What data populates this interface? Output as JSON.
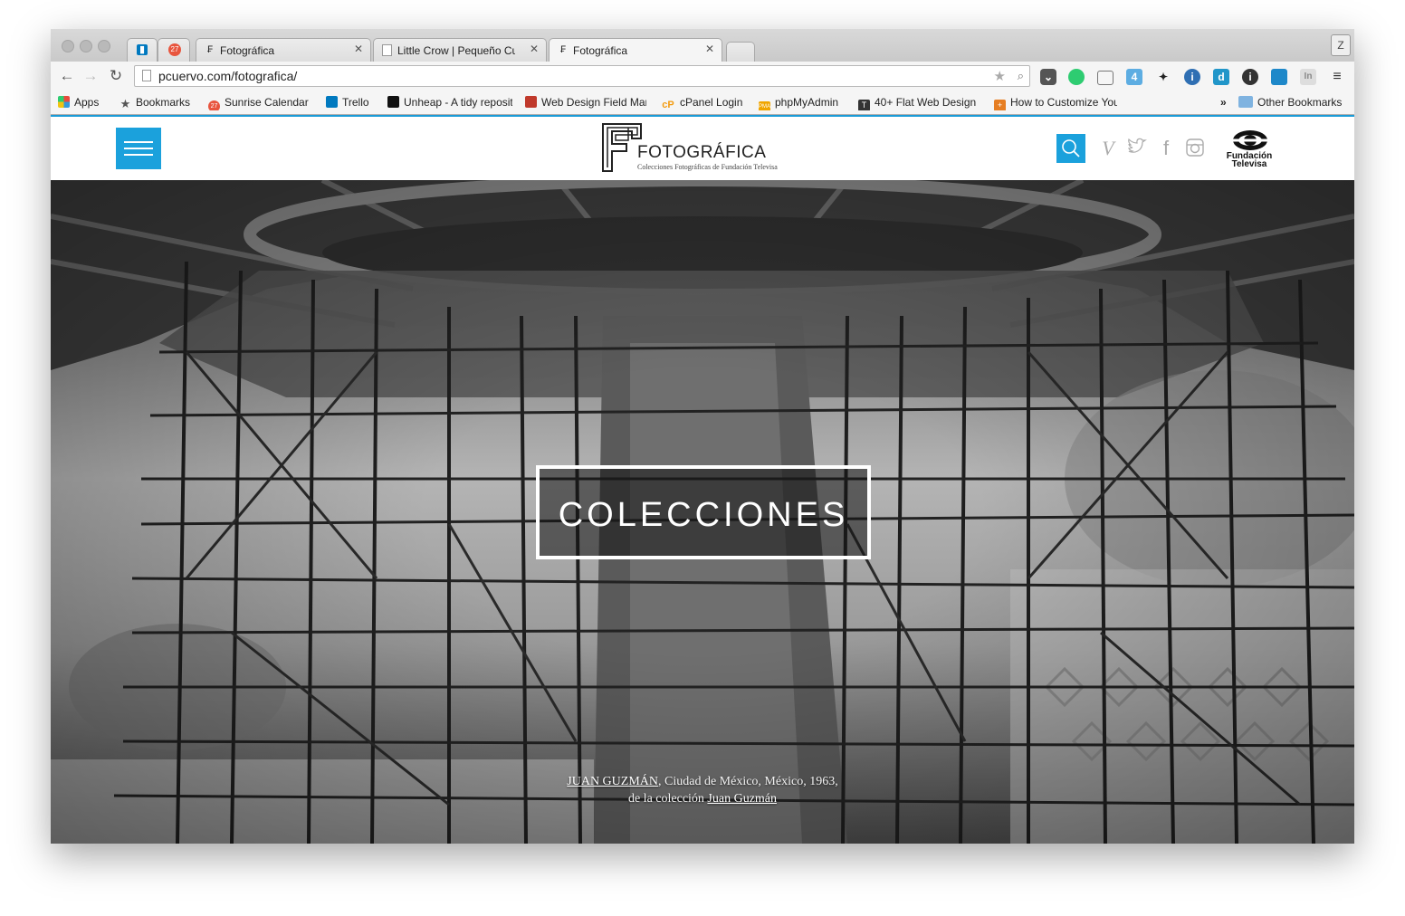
{
  "browser": {
    "tabs": [
      {
        "label": "",
        "icon": "trello-icon"
      },
      {
        "label": "",
        "icon": "calendar-27-icon",
        "badge": "27"
      },
      {
        "label": "Fotográfica",
        "icon": "fotografica-icon"
      },
      {
        "label": "Little Crow | Pequeño Cuervo",
        "icon": "page-icon"
      },
      {
        "label": "Fotográfica",
        "icon": "fotografica-icon"
      }
    ],
    "profile": "Z",
    "url": "pcuervo.com/fotografica/",
    "bookmarks": [
      {
        "label": "Apps",
        "icon": "apps-grid-icon",
        "color": "#e84a3c"
      },
      {
        "label": "Bookmarks",
        "icon": "star-icon",
        "color": "#555555"
      },
      {
        "label": "Sunrise Calendar",
        "icon": "calendar-27-icon",
        "color": "#e8553e"
      },
      {
        "label": "Trello",
        "icon": "trello-icon",
        "color": "#0079bf"
      },
      {
        "label": "Unheap - A tidy repository",
        "icon": "unheap-icon",
        "color": "#111111"
      },
      {
        "label": "Web Design Field Manual",
        "icon": "wdfm-icon",
        "color": "#c0392b"
      },
      {
        "label": "cPanel Login",
        "icon": "cpanel-icon",
        "color": "#f39c12"
      },
      {
        "label": "phpMyAdmin",
        "icon": "phpmyadmin-icon",
        "color": "#f0a500"
      },
      {
        "label": "40+ Flat Web Design",
        "icon": "t-icon",
        "color": "#333333"
      },
      {
        "label": "How to Customize Your",
        "icon": "plus-icon",
        "color": "#e67e22"
      }
    ],
    "bookmarks_overflow": "»",
    "other_bookmarks": "Other Bookmarks"
  },
  "site": {
    "logo_name": "FOTOGRÁFICA",
    "logo_tagline": "Colecciones Fotográficas de Fundación Televisa",
    "sponsor_line1": "Fundación",
    "sponsor_line2": "Televisa",
    "social": [
      "vimeo-icon",
      "twitter-icon",
      "facebook-icon",
      "instagram-icon"
    ]
  },
  "hero": {
    "title": "COLECCIONES",
    "caption_author": "JUAN GUZMÁN",
    "caption_place": ", Ciudad de México, México, 1963,",
    "caption_from": "de la colección ",
    "caption_collection": "Juan Guzmán"
  },
  "colors": {
    "accent": "#1ba1dc",
    "chrome_bg": "#f5f5f5"
  }
}
